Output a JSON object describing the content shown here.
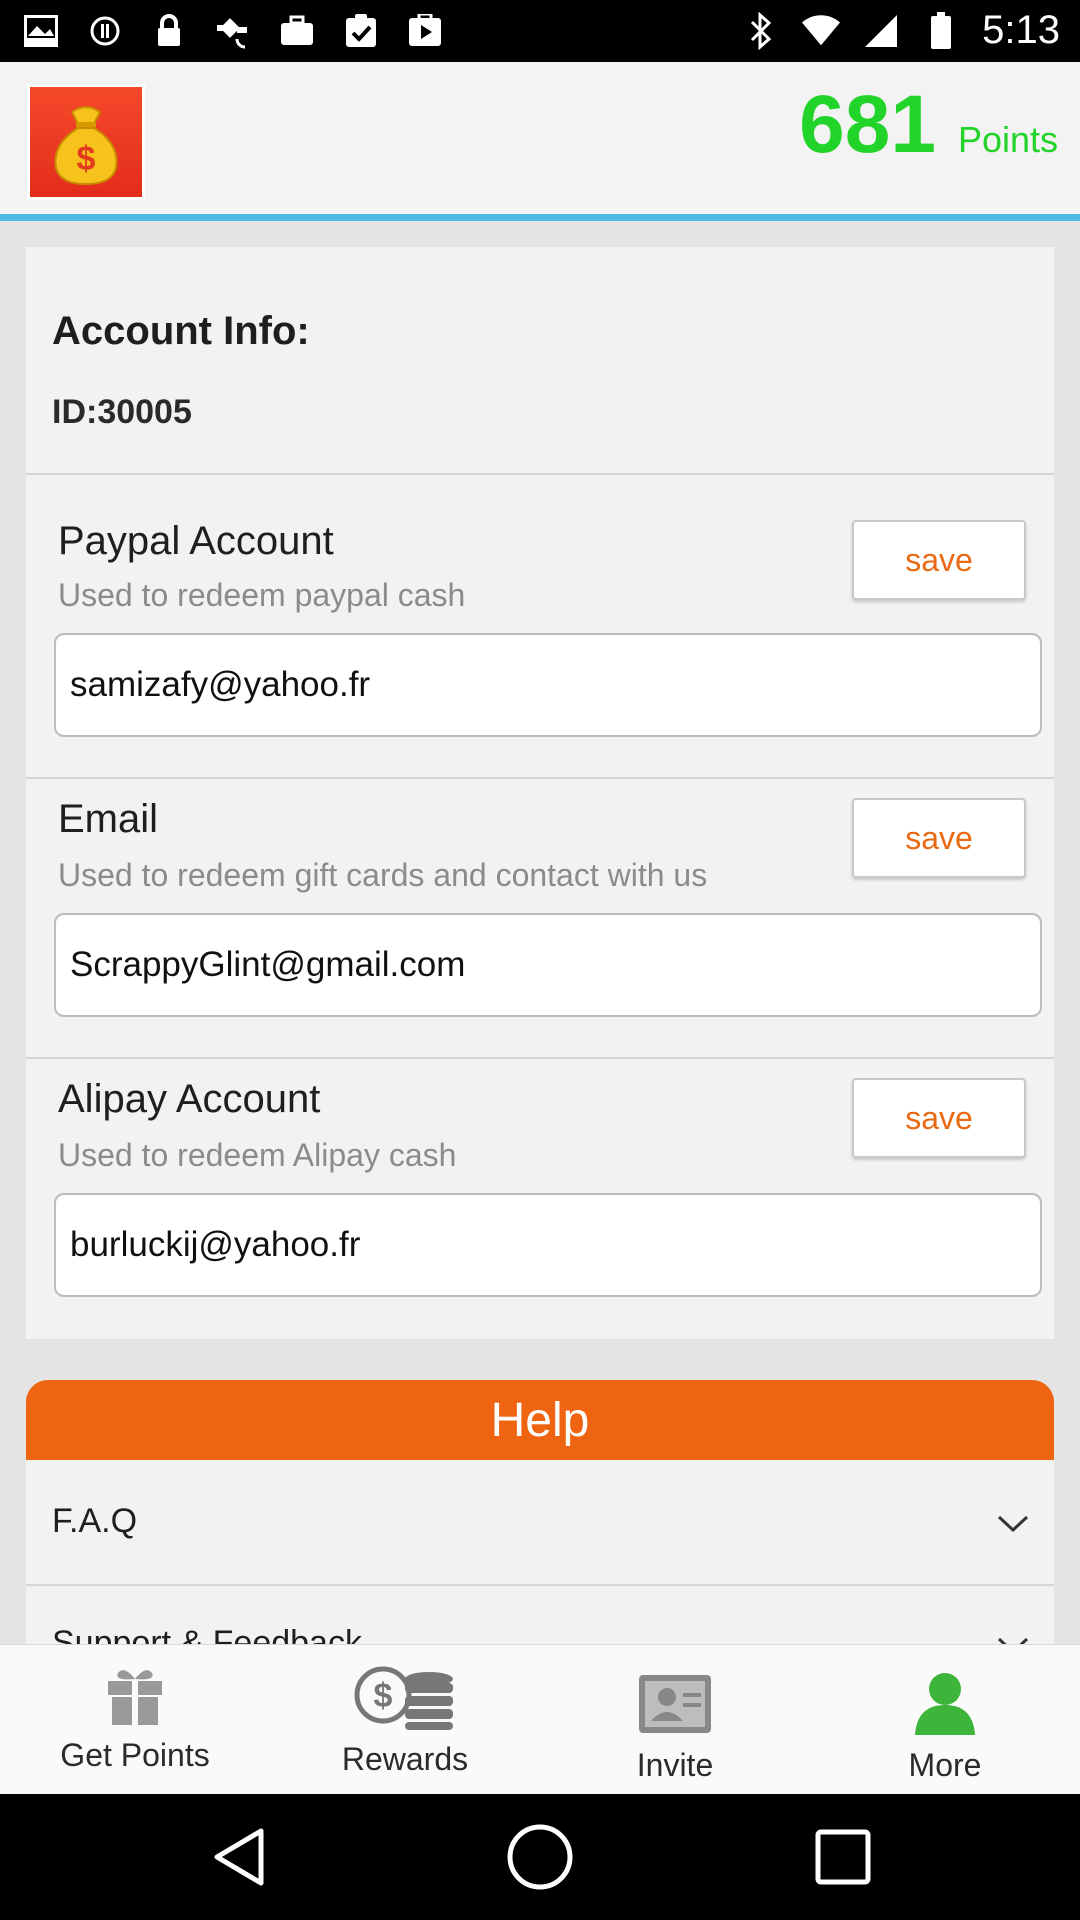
{
  "status_bar": {
    "time": "5:13",
    "icons": [
      "image-icon",
      "lock-icon",
      "fake-gps-icon",
      "lock-icon",
      "briefcase-icon",
      "clipboard-check-icon",
      "play-store-icon",
      "bluetooth-icon",
      "wifi-icon",
      "signal-icon",
      "battery-icon"
    ]
  },
  "header": {
    "logo_icon": "money-bag-icon",
    "points_value": "681",
    "points_label": "Points"
  },
  "account": {
    "title": "Account Info:",
    "id_text": "ID:30005",
    "sections": [
      {
        "title": "Paypal Account",
        "subtitle": "Used to redeem paypal cash",
        "save_label": "save",
        "value": "samizafy@yahoo.fr"
      },
      {
        "title": "Email",
        "subtitle": "Used to redeem gift cards and contact with us",
        "save_label": "save",
        "value": "ScrappyGlint@gmail.com"
      },
      {
        "title": "Alipay Account",
        "subtitle": "Used to redeem Alipay cash",
        "save_label": "save",
        "value": "burluckij@yahoo.fr"
      }
    ]
  },
  "help": {
    "title": "Help",
    "items": [
      "F.A.Q",
      "Support & Feedback"
    ]
  },
  "tabs": [
    {
      "label": "Get Points",
      "icon": "gift-icon"
    },
    {
      "label": "Rewards",
      "icon": "coins-icon"
    },
    {
      "label": "Invite",
      "icon": "contact-card-icon"
    },
    {
      "label": "More",
      "icon": "person-icon"
    }
  ],
  "colors": {
    "accent_orange": "#ee6410",
    "points_green": "#22d42a",
    "header_line_blue": "#4fb9e3",
    "save_text_orange": "#ea6a14"
  }
}
